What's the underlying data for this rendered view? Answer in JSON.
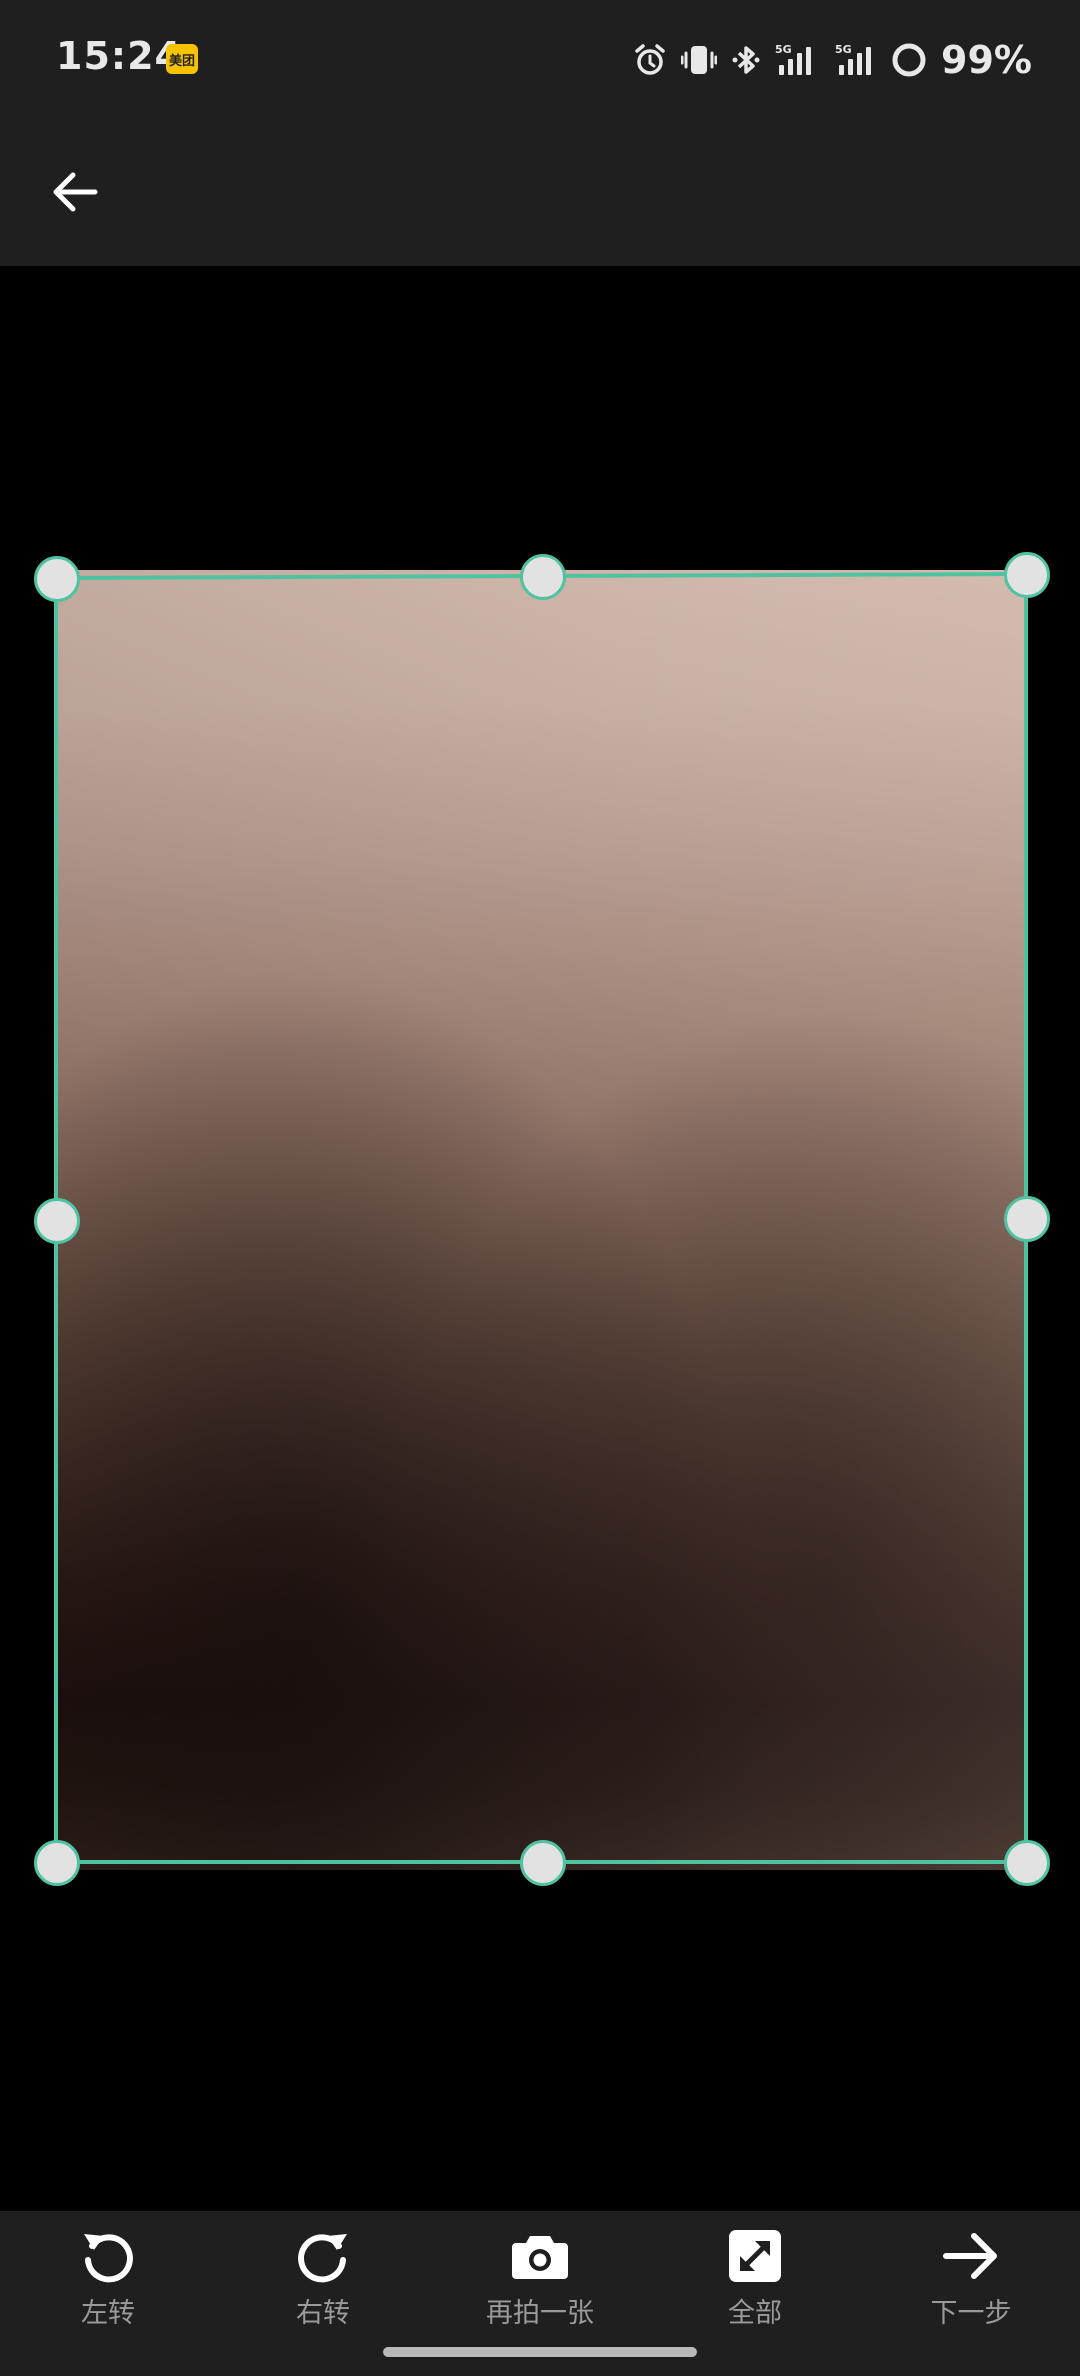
{
  "status_bar": {
    "time": "15:24",
    "badge_text": "美团",
    "battery": "99%",
    "icons": [
      "alarm-icon",
      "vibrate-icon",
      "bluetooth-icon",
      "signal-5g-icon",
      "signal-5g-icon",
      "battery-ring-icon"
    ]
  },
  "app_bar": {
    "back_icon": "arrow-left-icon"
  },
  "crop": {
    "accent_color": "#4fc3a1",
    "handle_color": "#e2e2e2"
  },
  "toolbar": {
    "rotate_left": "左转",
    "rotate_right": "右转",
    "retake": "再拍一张",
    "select_all": "全部",
    "next": "下一步"
  },
  "colors": {
    "bar_background": "#1f1f20",
    "label_gray": "#9a9a9a"
  }
}
